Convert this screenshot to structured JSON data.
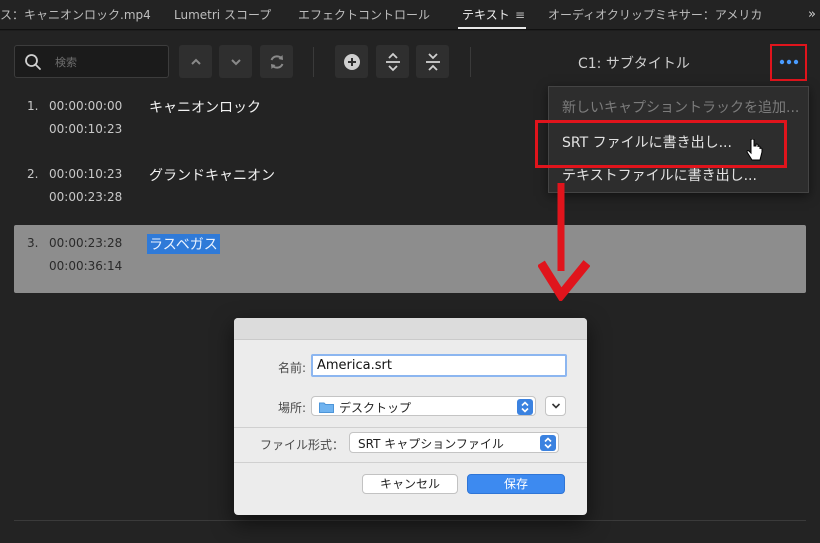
{
  "tabs": [
    {
      "label": "ス：キャニオンロック.mp4",
      "active": false
    },
    {
      "label": "Lumetri スコープ",
      "active": false
    },
    {
      "label": "エフェクトコントロール",
      "active": false
    },
    {
      "label": "テキスト",
      "active": true
    },
    {
      "label": "オーディオクリップミキサー：アメリカ",
      "active": false
    }
  ],
  "toolbar": {
    "search_placeholder": "検索",
    "caption_track": "C1: サブタイトル"
  },
  "captions": [
    {
      "num": "1.",
      "in": "00:00:00:00",
      "out": "00:00:10:23",
      "text": "キャニオンロック",
      "selected": false
    },
    {
      "num": "2.",
      "in": "00:00:10:23",
      "out": "00:00:23:28",
      "text": "グランドキャニオン",
      "selected": false
    },
    {
      "num": "3.",
      "in": "00:00:23:28",
      "out": "00:00:36:14",
      "text": "ラスベガス",
      "selected": true
    }
  ],
  "menu": {
    "items": [
      {
        "label": "新しいキャプショントラックを追加...",
        "enabled": false
      },
      {
        "label": "SRT ファイルに書き出し...",
        "enabled": true
      },
      {
        "label": "テキストファイルに書き出し...",
        "enabled": true
      }
    ]
  },
  "dialog": {
    "name_label": "名前:",
    "name_value": "America.srt",
    "location_label": "場所:",
    "location_value": "デスクトップ",
    "format_label": "ファイル形式：",
    "format_value": "SRT キャプションファイル",
    "cancel_label": "キャンセル",
    "save_label": "保存"
  },
  "colors": {
    "highlight_red": "#e0141c",
    "selection_blue": "#2f7ad8",
    "primary_button": "#3d8af0"
  },
  "icons": [
    "search-icon",
    "chevron-up-icon",
    "chevron-down-icon",
    "refresh-icon",
    "plus-circle-icon",
    "split-icon",
    "merge-icon",
    "more-icon",
    "folder-icon",
    "pointer-cursor-icon",
    "down-arrow-icon"
  ]
}
